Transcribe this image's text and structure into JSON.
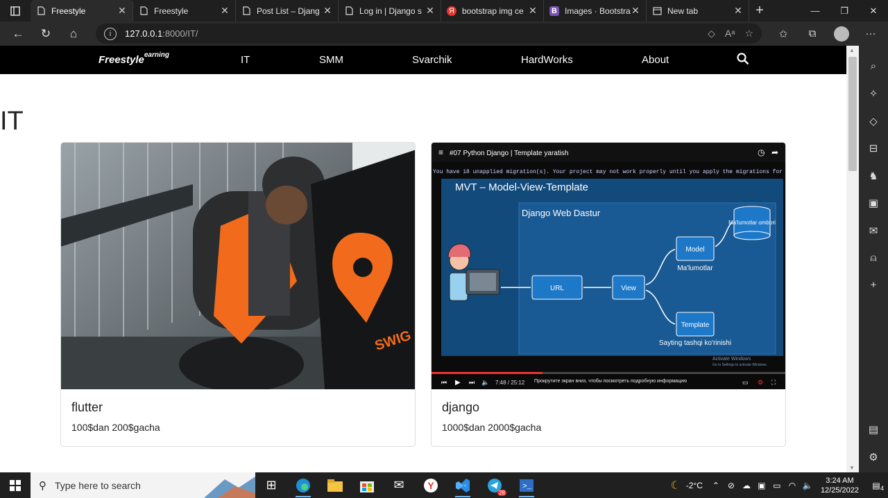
{
  "browser": {
    "tabs": [
      {
        "title": "Freestyle",
        "icon": "page-icon",
        "active": true
      },
      {
        "title": "Freestyle",
        "icon": "page-icon"
      },
      {
        "title": "Post List – Djang",
        "icon": "page-icon"
      },
      {
        "title": "Log in | Django s",
        "icon": "page-icon"
      },
      {
        "title": "bootstrap img ce",
        "icon": "yandex-icon"
      },
      {
        "title": "Images · Bootstra",
        "icon": "bootstrap-icon"
      },
      {
        "title": "New tab",
        "icon": "newtab-icon"
      }
    ],
    "url_host": "127.0.0.1",
    "url_rest": ":8000/IT/"
  },
  "site": {
    "brand": "Freestyle",
    "brand_sup": "earning",
    "nav": [
      "IT",
      "SMM",
      "Svarchik",
      "HardWorks",
      "About"
    ]
  },
  "page": {
    "heading": "IT",
    "cards": [
      {
        "title": "flutter",
        "price": "100$dan 200$gacha"
      },
      {
        "title": "django",
        "price": "1000$dan 2000$gacha"
      }
    ]
  },
  "video": {
    "title": "#07 Python Django | Template yaratish",
    "console": "You have 18 unapplied migration(s). Your project may not work properly until you apply the migrations for app(s",
    "slide_title": "MVT – Model-View-Template",
    "box_title": "Django Web Dastur",
    "db": "Ma'lumotlar ombori",
    "model": "Model",
    "model_caption": "Ma'lumotlar",
    "url": "URL",
    "view": "View",
    "template": "Template",
    "template_caption": "Sayting tashqi ko'rinishi",
    "time": "7:48 / 25:12",
    "hint": "Прокрутите экран вниз, чтобы посмотреть подробную информацию",
    "activate": "Activate Windows",
    "activate_sub": "Go to Settings to activate Windows."
  },
  "taskbar": {
    "search_placeholder": "Type here to search",
    "weather": "-2°C",
    "time": "3:24 AM",
    "date": "12/25/2022",
    "notifications": "4",
    "telegram_badge": "28"
  }
}
